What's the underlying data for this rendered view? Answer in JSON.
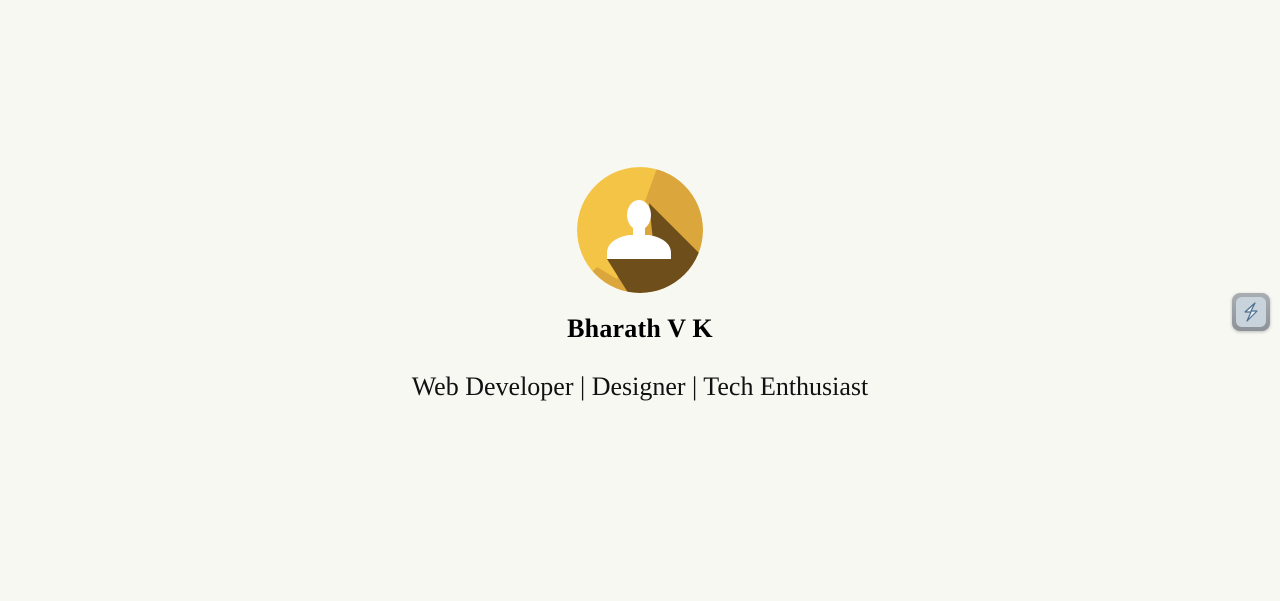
{
  "profile": {
    "avatar_icon": "user-silhouette-icon",
    "name": "Bharath V K",
    "tagline": "Web Developer | Designer | Tech Enthusiast"
  },
  "widget": {
    "icon": "lightning-s-icon"
  },
  "colors": {
    "background": "#f8f8f3",
    "avatar_primary": "#f3c446",
    "avatar_secondary": "#dba63b",
    "avatar_shadow": "#6e4e1b"
  }
}
